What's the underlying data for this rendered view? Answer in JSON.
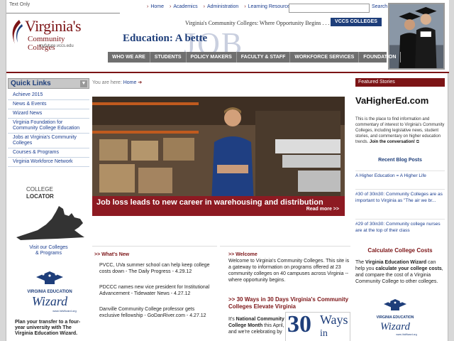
{
  "header": {
    "text_only": "Text Only",
    "top_nav": [
      "Home",
      "Academics",
      "Administration",
      "Learning Resources"
    ],
    "search_button": "Search",
    "search_value": "",
    "logo_line1": "Virginia's",
    "logo_line2": "Community Colleges",
    "logo_line3": "myfuture.vccs.edu",
    "tagline": "Virginia's Community Colleges: Where Opportunity Begins . . .",
    "vccs_badge": "VCCS COLLEGES",
    "edu_title": "Education: A bette",
    "edu_job": "JOB",
    "main_nav": [
      "WHO WE ARE",
      "STUDENTS",
      "POLICY MAKERS",
      "FACULTY & STAFF",
      "WORKFORCE SERVICES",
      "FOUNDATION"
    ]
  },
  "left": {
    "quick_links_title": "Quick Links",
    "quick_links_toggle": "▼",
    "quick_links": [
      "Achieve 2015",
      "News & Events",
      "Wizard News",
      "Virginia Foundation for Community College Education",
      "Jobs at Virginia's Community Colleges",
      "Courses & Programs",
      "Virginia Workforce Network"
    ],
    "locator_line1": "COLLEGE",
    "locator_line2": "LOCATOR",
    "locator_link1": "Visit our Colleges",
    "locator_link2": "& Programs",
    "wizard_text": "Plan your transfer to a four-year university with The Virginia Education Wizard."
  },
  "center": {
    "crumb_prefix": "You are here:",
    "crumb_home": "Home",
    "hero_title": "Job loss leads to new career in warehousing and distribution",
    "hero_more": "Read more >>",
    "whats_new_title": ">> What's New",
    "news": [
      "PVCC, UVa summer school can help keep college costs down - The Daily Progress - 4.29.12",
      "PDCCC names new vice president for Institutional Advancement - Tidewater News - 4.27.12",
      "Danville Community College professor gets exclusive fellowship - GoDanRiver.com - 4.27.12"
    ],
    "welcome_title": ">> Welcome",
    "welcome_text": "Welcome to Virginia's Community Colleges. This site is a gateway to information on programs offered at 23 community colleges on 40 campuses across Virginia -- where opportunity begins.",
    "w30_title": ">> 30 Ways in 30 Days Virginia's Community Colleges Elevate Virginia",
    "w30_text_pre": "It's ",
    "w30_text_bold": "National Community College Month",
    "w30_text_post": " this April, and we're celebrating by",
    "w30_num": "30",
    "w30_ways": "Ways",
    "w30_in": "in"
  },
  "right": {
    "featured_header": "Featured Stories",
    "vh_title": "VaHigherEd.com",
    "vh_text": "This is the place to find information and commentary of interest to Virginia's Community Colleges, including legislative news, student stories, and commentary on higher education trends.",
    "vh_join": "Join the conversation!",
    "recent_title": "Recent Blog Posts",
    "blog": [
      "A Higher Education = A Higher Life",
      "#30 of 30in30: Community Colleges are as important to Virginia as \"The air we br...",
      "#29 of 30in30: Community college nurses are at the top of their class"
    ],
    "calc_title": "Calculate College Costs",
    "calc_pre": "The ",
    "calc_b1": "Virginia Education Wizard",
    "calc_mid1": " can help you ",
    "calc_b2": "calculate your college costs",
    "calc_mid2": ", and compare the cost of a Virginia Community College to other colleges."
  },
  "wizard_logo": {
    "top": "VIRGINIA EDUCATION",
    "word": "Wizard",
    "url": "www.VaWizard.org"
  },
  "colors": {
    "maroon": "#7c1416",
    "navy": "#1e3e7a",
    "nav_gray": "#6f6f6f",
    "link": "#1a3d8f"
  }
}
